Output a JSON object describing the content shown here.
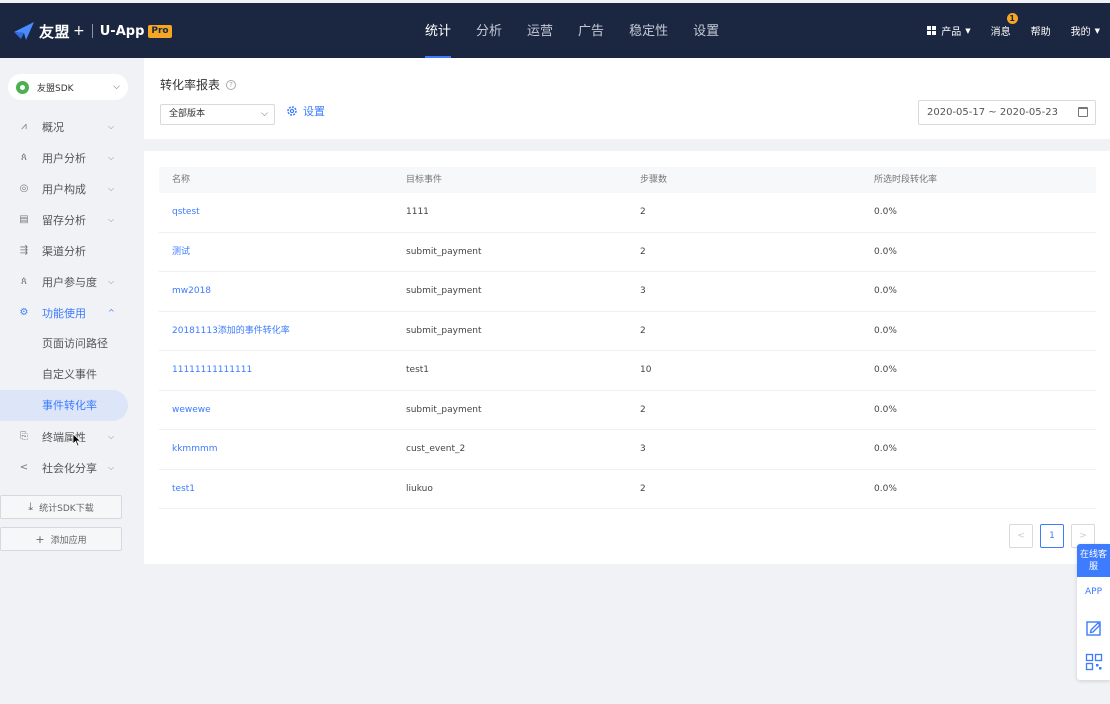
{
  "topbar": {
    "brand": "友盟",
    "plus": "+",
    "product": "U-App",
    "pro_badge": "Pro",
    "nav": [
      "统计",
      "分析",
      "运营",
      "广告",
      "稳定性",
      "设置"
    ],
    "active_nav": "统计",
    "products_label": "产品",
    "messages_label": "消息",
    "messages_badge": "1",
    "help_label": "帮助",
    "mine_label": "我的"
  },
  "sidebar": {
    "app_name": "友盟SDK",
    "items": [
      {
        "label": "概况",
        "icon": "chart-icon",
        "chevron": "down"
      },
      {
        "label": "用户分析",
        "icon": "user-analysis-icon",
        "chevron": "down"
      },
      {
        "label": "用户构成",
        "icon": "user-composition-icon",
        "chevron": "down"
      },
      {
        "label": "留存分析",
        "icon": "retention-icon",
        "chevron": "down"
      },
      {
        "label": "渠道分析",
        "icon": "channel-icon",
        "chevron": ""
      },
      {
        "label": "用户参与度",
        "icon": "engagement-icon",
        "chevron": "down"
      },
      {
        "label": "功能使用",
        "icon": "feature-icon",
        "chevron": "up"
      }
    ],
    "subitems": [
      "页面访问路径",
      "自定义事件",
      "事件转化率"
    ],
    "active_subitem": "事件转化率",
    "items_after": [
      {
        "label": "终端属性",
        "icon": "device-icon",
        "chevron": "down"
      },
      {
        "label": "社会化分享",
        "icon": "share-icon",
        "chevron": "down"
      }
    ],
    "sdk_download_label": "统计SDK下载",
    "add_app_label": "添加应用"
  },
  "header": {
    "title": "转化率报表",
    "version_select": "全部版本",
    "settings_label": "设置",
    "date_range": "2020-05-17 ~ 2020-05-23"
  },
  "table": {
    "columns": [
      "名称",
      "目标事件",
      "步骤数",
      "所选时段转化率"
    ],
    "rows": [
      {
        "name": "qstest",
        "event": "1111",
        "steps": "2",
        "rate": "0.0%"
      },
      {
        "name": "测试",
        "event": "submit_payment",
        "steps": "2",
        "rate": "0.0%"
      },
      {
        "name": "mw2018",
        "event": "submit_payment",
        "steps": "3",
        "rate": "0.0%"
      },
      {
        "name": "20181113添加的事件转化率",
        "event": "submit_payment",
        "steps": "2",
        "rate": "0.0%"
      },
      {
        "name": "11111111111111",
        "event": "test1",
        "steps": "10",
        "rate": "0.0%"
      },
      {
        "name": "wewewe",
        "event": "submit_payment",
        "steps": "2",
        "rate": "0.0%"
      },
      {
        "name": "kkmmmm",
        "event": "cust_event_2",
        "steps": "3",
        "rate": "0.0%"
      },
      {
        "name": "test1",
        "event": "liukuo",
        "steps": "2",
        "rate": "0.0%"
      }
    ]
  },
  "pagination": {
    "prev": "<",
    "current_page": "1",
    "next": ">"
  },
  "float_tools": {
    "online_service": "在线客服",
    "app_label": "APP"
  },
  "colors": {
    "topbar_bg": "#1b2640",
    "accent": "#3d7bff",
    "badge": "#f5a623"
  }
}
